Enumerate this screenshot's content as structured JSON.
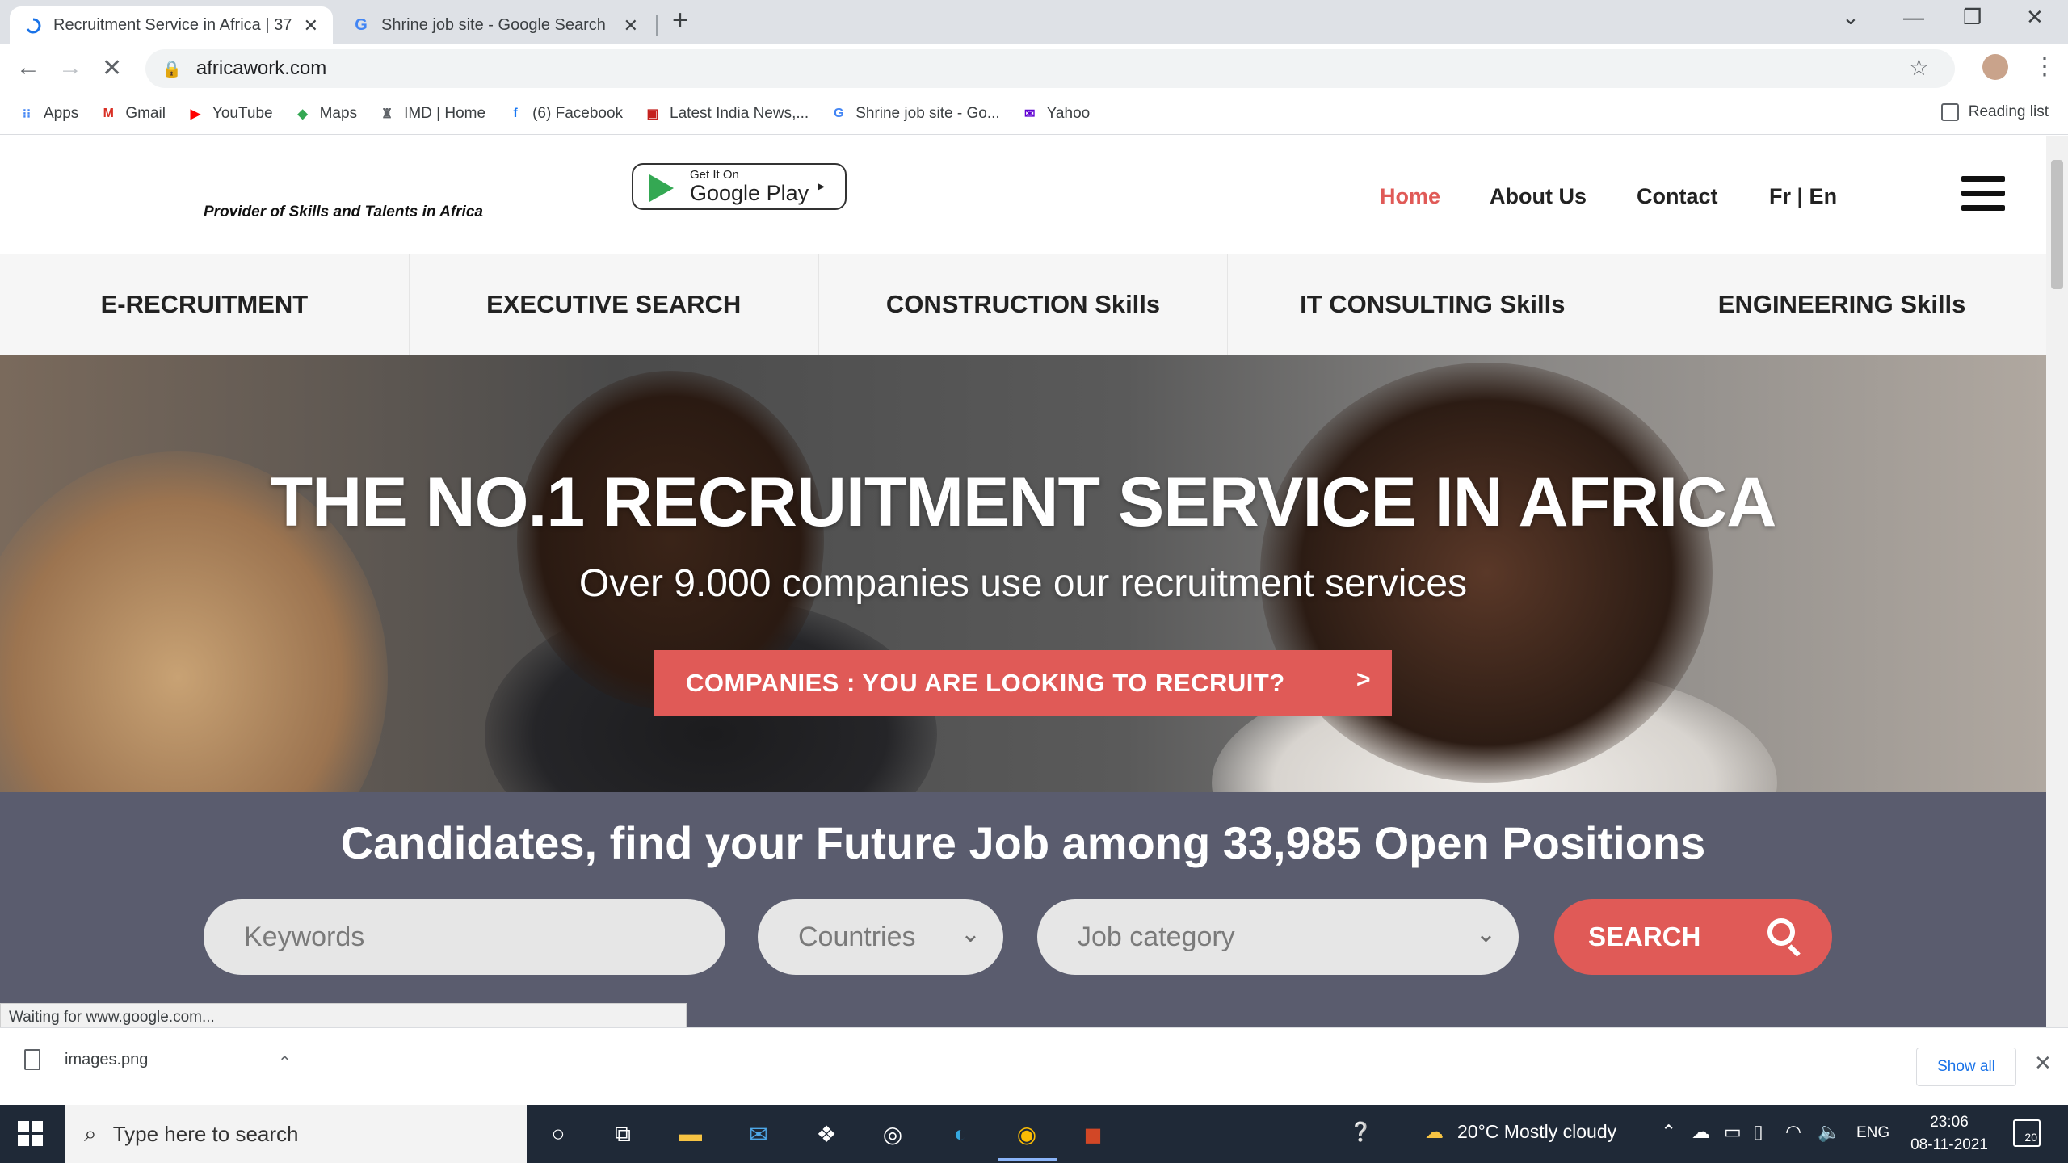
{
  "browser": {
    "tabs": [
      {
        "title": "Recruitment Service in Africa | 37",
        "active": true
      },
      {
        "title": "Shrine job site - Google Search",
        "active": false
      }
    ],
    "new_tab_symbol": "+",
    "window_controls": [
      "⌄",
      "—",
      "❐",
      "✕"
    ],
    "url": "africawork.com",
    "bookmarks": [
      {
        "label": "Apps",
        "icon": "apps-grid-icon"
      },
      {
        "label": "Gmail",
        "icon": "gmail-icon"
      },
      {
        "label": "YouTube",
        "icon": "youtube-icon"
      },
      {
        "label": "Maps",
        "icon": "maps-icon"
      },
      {
        "label": "IMD | Home",
        "icon": "imd-icon"
      },
      {
        "label": "(6) Facebook",
        "icon": "facebook-icon"
      },
      {
        "label": "Latest India News,...",
        "icon": "news-icon"
      },
      {
        "label": "Shrine job site - Go...",
        "icon": "google-icon"
      },
      {
        "label": "Yahoo",
        "icon": "yahoo-mail-icon"
      }
    ],
    "reading_list": "Reading list",
    "status_text": "Waiting for www.google.com...",
    "colors": {
      "accent": "#1a73e8",
      "tab_strip": "#dee1e6"
    }
  },
  "site": {
    "tagline": "Provider of Skills and Talents in Africa",
    "google_play": {
      "small": "Get It On",
      "big": "Google Play",
      "arrow": "▸"
    },
    "nav": {
      "home": "Home",
      "about": "About Us",
      "contact": "Contact",
      "lang": "Fr | En"
    },
    "categories": [
      "E-RECRUITMENT",
      "EXECUTIVE SEARCH",
      "CONSTRUCTION Skills",
      "IT CONSULTING Skills",
      "ENGINEERING Skills"
    ],
    "hero": {
      "title": "THE NO.1 RECRUITMENT SERVICE IN AFRICA",
      "subtitle": "Over 9.000 companies use our recruitment services",
      "cta": "COMPANIES : YOU ARE LOOKING TO RECRUIT?",
      "cta_arrow": ">"
    },
    "search": {
      "title": "Candidates, find your Future Job among 33,985 Open Positions",
      "keywords_placeholder": "Keywords",
      "countries": "Countries",
      "job_category": "Job category",
      "button": "SEARCH"
    },
    "colors": {
      "brand_red": "#e05a57",
      "band": "#5a5c6e",
      "nav_active": "#e05a57"
    }
  },
  "downloads": {
    "file": "images.png",
    "show_all": "Show all"
  },
  "taskbar": {
    "search_placeholder": "Type here to search",
    "weather": "20°C  Mostly cloudy",
    "lang": "ENG",
    "time": "23:06",
    "date": "08-11-2021",
    "notification_count": "20"
  }
}
